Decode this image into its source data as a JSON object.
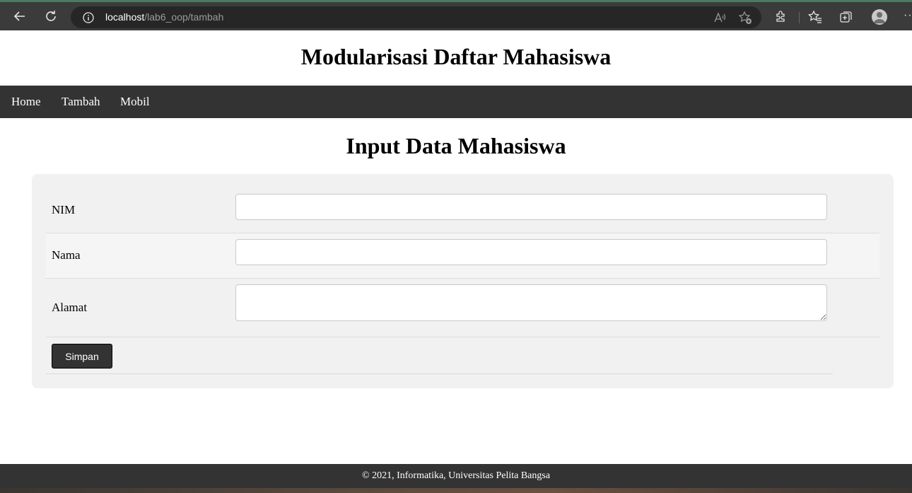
{
  "browser": {
    "url_host": "localhost",
    "url_path": "/lab6_oop/tambah",
    "read_aloud_label": "A⁾",
    "more_label": "···"
  },
  "site": {
    "title": "Modularisasi Daftar Mahasiswa"
  },
  "nav": {
    "items": [
      {
        "label": "Home"
      },
      {
        "label": "Tambah"
      },
      {
        "label": "Mobil"
      }
    ]
  },
  "main": {
    "heading": "Input Data Mahasiswa",
    "form": {
      "nim_label": "NIM",
      "nim_value": "",
      "nama_label": "Nama",
      "nama_value": "",
      "alamat_label": "Alamat",
      "alamat_value": "",
      "submit_label": "Simpan"
    }
  },
  "footer": {
    "text": "© 2021, Informatika, Universitas Pelita Bangsa"
  },
  "colors": {
    "navbar": "#333333",
    "form_background": "#f1f1f1",
    "browser_chrome": "#3b3b3b"
  },
  "icons": [
    "back-icon",
    "reload-icon",
    "info-icon",
    "read-aloud-icon",
    "favorite-add-icon",
    "extensions-icon",
    "favorites-icon",
    "collections-icon",
    "profile-icon",
    "more-icon"
  ]
}
